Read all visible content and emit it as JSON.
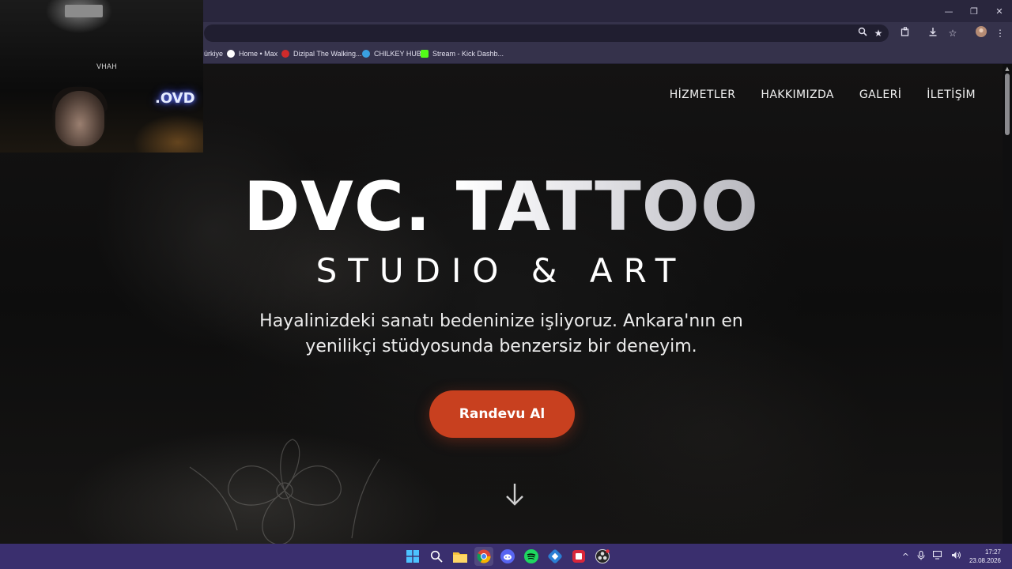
{
  "browser": {
    "window_controls": {
      "minimize": "—",
      "restore": "❐",
      "close": "✕"
    },
    "toolbar_icons": [
      "zoom-icon",
      "star-icon",
      "extensions-icon",
      "download-icon",
      "favorites-icon",
      "profile-avatar",
      "more-icon"
    ],
    "bookmarks": [
      {
        "label": "ürkiye",
        "icon": "truncated-icon",
        "color": "#35324b"
      },
      {
        "label": "Home • Max",
        "icon": "max-icon",
        "color": "#ffffff"
      },
      {
        "label": "Dizipal The Walking...",
        "icon": "dizipal-icon",
        "color": "#d02b2b"
      },
      {
        "label": "CHILKEY HUB",
        "icon": "chilkey-icon",
        "color": "#3aa0e0"
      },
      {
        "label": "Stream - Kick Dashb...",
        "icon": "kick-icon",
        "color": "#53fc18"
      }
    ]
  },
  "site": {
    "nav": [
      "HİZMETLER",
      "HAKKIMIZDA",
      "GALERİ",
      "İLETİŞİM"
    ],
    "hero": {
      "title_part1": "DVC.",
      "title_part2": "TATTOO",
      "subtitle": "STUDIO & ART",
      "description": "Hayalinizdeki sanatı bedeninize işliyoruz. Ankara'nın en yenilikçi stüdyosunda benzersiz bir deneyim.",
      "cta_label": "Randevu Al"
    },
    "colors": {
      "cta": "#c8401f",
      "background": "#0e0e0e"
    }
  },
  "webcam": {
    "neon_text": ".OVD",
    "mirror_text": "VHAH"
  },
  "taskbar": {
    "apps": [
      "windows-start-icon",
      "search-icon",
      "file-explorer-icon",
      "chrome-icon",
      "discord-icon",
      "spotify-icon",
      "vpn-icon",
      "app-red-icon",
      "obs-icon"
    ],
    "clock": {
      "time": "17:27",
      "date": "23.08.2026"
    }
  }
}
